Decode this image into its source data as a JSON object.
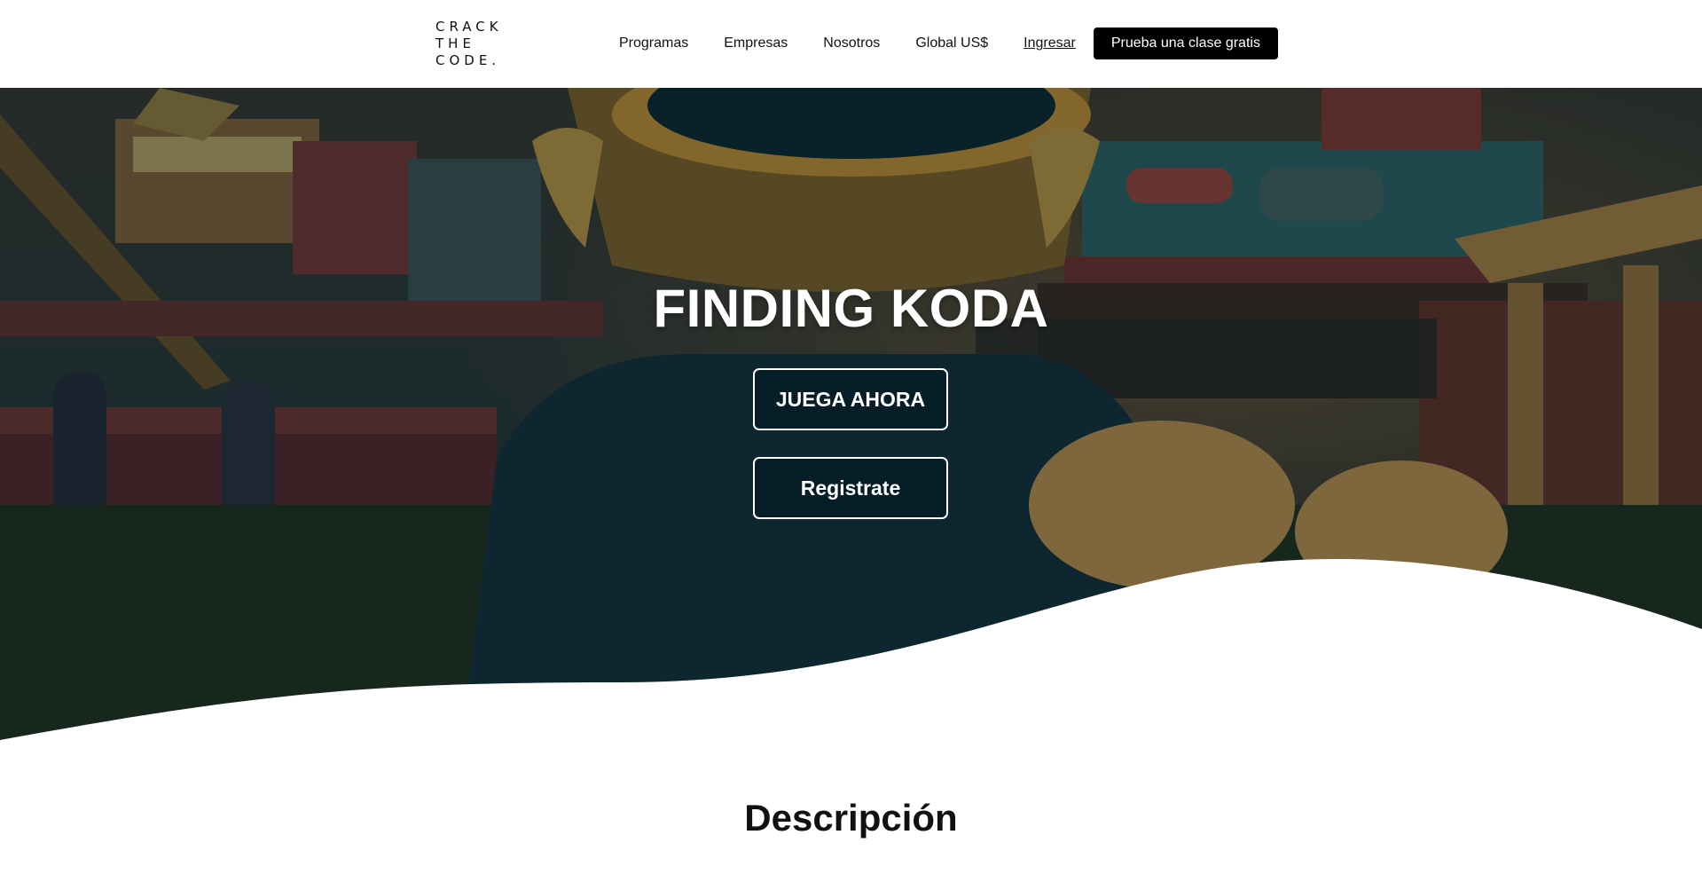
{
  "header": {
    "logo_lines": [
      "CRACK",
      "THE",
      "CODE."
    ],
    "nav": {
      "programas": "Programas",
      "empresas": "Empresas",
      "nosotros": "Nosotros",
      "global": "Global US$",
      "ingresar": "Ingresar"
    },
    "cta_label": "Prueba una clase gratis"
  },
  "hero": {
    "title": "FINDING KODA",
    "play_label": "JUEGA AHORA",
    "register_label": "Registrate"
  },
  "description": {
    "title": "Descripción"
  },
  "colors": {
    "accent": "#000000",
    "hero_overlay": "#05121c",
    "button_bg": "#021a24",
    "button_border": "#ffffff"
  }
}
